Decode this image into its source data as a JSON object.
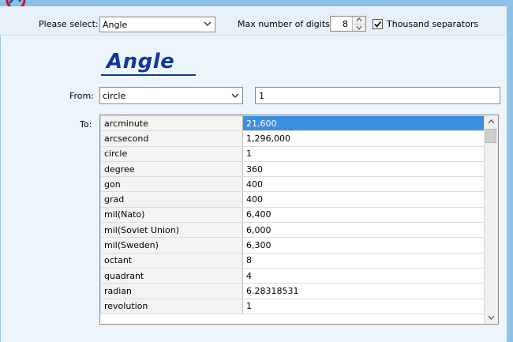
{
  "toolbar": {
    "select_label": "Please select:",
    "category_value": "Angle",
    "max_digits_label": "Max number of digits:",
    "max_digits_value": "8",
    "thousand_separators_label": "Thousand separators",
    "thousand_separators_checked": true
  },
  "main": {
    "title": "Angle",
    "from_label": "From:",
    "from_unit": "circle",
    "from_value": "1",
    "to_label": "To:"
  },
  "results": [
    {
      "unit": "arcminute",
      "value": "21,600",
      "selected": true
    },
    {
      "unit": "arcsecond",
      "value": "1,296,000"
    },
    {
      "unit": "circle",
      "value": "1"
    },
    {
      "unit": "degree",
      "value": "360"
    },
    {
      "unit": "gon",
      "value": "400"
    },
    {
      "unit": "grad",
      "value": "400"
    },
    {
      "unit": "mil(Nato)",
      "value": "6,400"
    },
    {
      "unit": "mil(Soviet Union)",
      "value": "6,000"
    },
    {
      "unit": "mil(Sweden)",
      "value": "6,300"
    },
    {
      "unit": "octant",
      "value": "8"
    },
    {
      "unit": "quadrant",
      "value": "4"
    },
    {
      "unit": "radian",
      "value": "6.28318531"
    },
    {
      "unit": "revolution",
      "value": "1"
    }
  ],
  "colors": {
    "title": "#12379a",
    "selection": "#3b8fe0",
    "panel": "#edf5fc"
  },
  "icons": {
    "logo": "app-logo-icon",
    "dropdown": "chevron-down-icon",
    "spin_up": "spin-up-icon",
    "spin_down": "spin-down-icon",
    "check": "check-icon",
    "scroll_up": "scroll-up-icon",
    "scroll_down": "scroll-down-icon"
  }
}
